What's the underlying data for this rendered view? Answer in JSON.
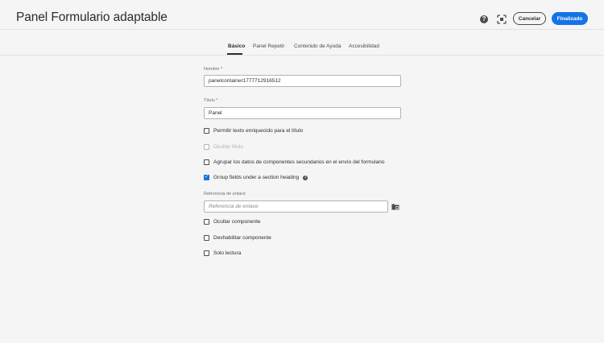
{
  "header": {
    "title": "Panel Formulario adaptable",
    "help_icon": "help-icon",
    "fullscreen_icon": "fullscreen-icon",
    "cancel_label": "Cancelar",
    "done_label": "Finalizado"
  },
  "tabs": [
    {
      "label": "Básico",
      "active": true
    },
    {
      "label": "Panel Repetir",
      "active": false
    },
    {
      "label": "Contenido de Ayuda",
      "active": false
    },
    {
      "label": "Accesibilidad",
      "active": false
    }
  ],
  "form": {
    "name_label": "Nombre *",
    "name_value": "panelcontainer1777712916512",
    "title_label": "Título *",
    "title_value": "Panel",
    "checkboxes_top": [
      {
        "label": "Permitir texto enriquecido para el título",
        "checked": false,
        "disabled": false
      },
      {
        "label": "Ocultar título",
        "checked": false,
        "disabled": true
      },
      {
        "label": "Agrupar los datos de componentes secundarios en el envío del formulario",
        "checked": false,
        "disabled": false
      },
      {
        "label": "Group fields under a section heading",
        "checked": true,
        "disabled": false
      }
    ],
    "link_ref_label": "Referencia de enlace",
    "link_ref_placeholder": "Referencia de enlace",
    "checkboxes_bottom": [
      {
        "label": "Ocultar componente",
        "checked": false,
        "disabled": false
      },
      {
        "label": "Deshabilitar componente",
        "checked": false,
        "disabled": false
      },
      {
        "label": "Solo lectura",
        "checked": false,
        "disabled": false
      }
    ]
  },
  "colors": {
    "accent": "#1473e6",
    "background": "#f5f5f5"
  }
}
